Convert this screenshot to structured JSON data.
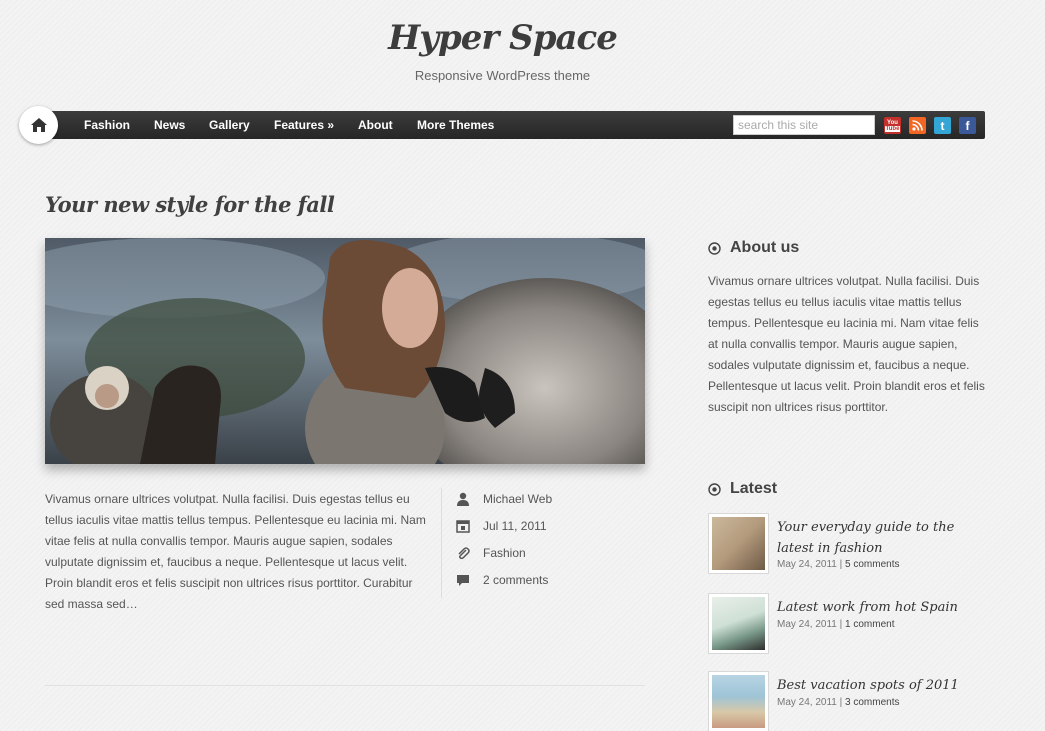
{
  "site": {
    "title": "Hyper Space",
    "tagline": "Responsive WordPress theme"
  },
  "nav": {
    "items": [
      "Fashion",
      "News",
      "Gallery",
      "Features »",
      "About",
      "More Themes"
    ],
    "search_placeholder": "search this site",
    "social": [
      "youtube-icon",
      "rss-icon",
      "twitter-icon",
      "facebook-icon"
    ]
  },
  "post": {
    "title": "Your new style for the fall",
    "excerpt": "Vivamus ornare ultrices volutpat. Nulla facilisi. Duis egestas tellus eu tellus iaculis vitae mattis tellus tempus. Pellentesque eu lacinia mi. Nam vitae felis at nulla convallis tempor. Mauris augue sapien, sodales vulputate dignissim et, faucibus a neque. Pellentesque ut lacus velit. Proin blandit eros et felis suscipit non ultrices risus porttitor. Curabitur sed massa sed…",
    "author": "Michael Web",
    "date": "Jul 11, 2011",
    "category": "Fashion",
    "comments": "2 comments"
  },
  "sidebar": {
    "about": {
      "title": "About us",
      "text": "Vivamus ornare ultrices volutpat. Nulla facilisi. Duis egestas tellus eu tellus iaculis vitae mattis tellus tempus. Pellentesque eu lacinia mi. Nam vitae felis at nulla convallis tempor. Mauris augue sapien, sodales vulputate dignissim et, faucibus a neque. Pellentesque ut lacus velit. Proin blandit eros et felis suscipit non ultrices risus porttitor."
    },
    "latest": {
      "title": "Latest",
      "items": [
        {
          "title": "Your everyday guide to the latest in fashion",
          "date": "May 24, 2011",
          "sep": " | ",
          "comments": "5 comments"
        },
        {
          "title": "Latest work from hot Spain",
          "date": "May 24, 2011",
          "sep": " | ",
          "comments": "1 comment"
        },
        {
          "title": "Best vacation spots of 2011",
          "date": "May 24, 2011",
          "sep": " | ",
          "comments": "3 comments"
        }
      ]
    }
  },
  "colors": {
    "navbar": "#2f2f2f",
    "youtube": "#c4302b",
    "rss": "#f26522",
    "twitter": "#33a6d6",
    "facebook": "#3b5998"
  }
}
